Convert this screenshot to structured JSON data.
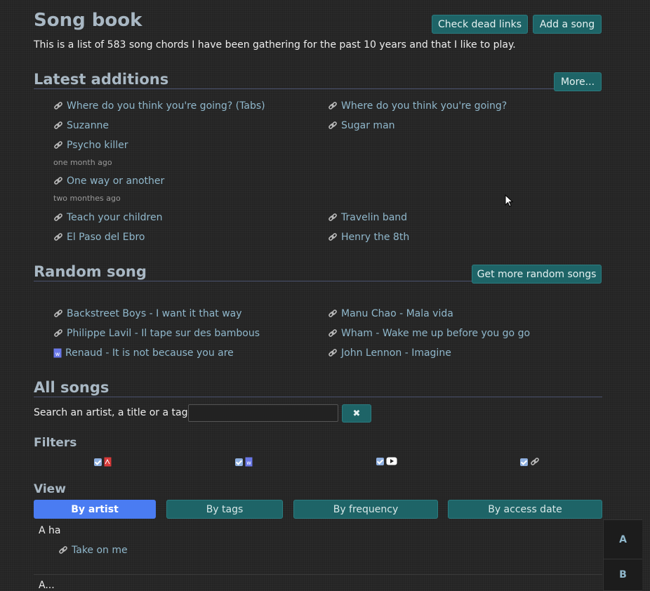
{
  "header": {
    "title": "Song book",
    "intro": "This is a list of 583 song chords I have been gathering for the past 10 years and that I like to play.",
    "check_dead_links": "Check dead links",
    "add_song": "Add a song"
  },
  "latest": {
    "title": "Latest additions",
    "more": "More...",
    "songs": [
      "Where do you think you're going? (Tabs)",
      "Where do you think you're going?",
      "Suzanne",
      "Sugar man",
      "Psycho killer",
      "One way or another",
      "Teach your children",
      "Travelin band",
      "El Paso del Ebro",
      "Henry the 8th"
    ],
    "dates": [
      "one month ago",
      "two monthes ago"
    ]
  },
  "random": {
    "title": "Random song",
    "more": "Get more random songs",
    "songs": [
      "Backstreet Boys - I want it that way",
      "Manu Chao - Mala vida",
      "Philippe Lavil - Il tape sur des bambous",
      "Wham - Wake me up before you go go",
      "Renaud - It is not because you are",
      "John Lennon - Imagine"
    ]
  },
  "all": {
    "title": "All songs",
    "search_label": "Search an artist, a title or a tag:",
    "search_value": "",
    "clear": "✖",
    "filters_title": "Filters",
    "view_title": "View",
    "tabs": [
      "By artist",
      "By tags",
      "By frequency",
      "By access date"
    ],
    "active_tab": "By artist",
    "artist": "A ha",
    "artist_song": "Take on me",
    "next_artist": "A..."
  },
  "index_letters": [
    "A",
    "B"
  ],
  "colors": {
    "accent": "#1e6467",
    "active_tab": "#4a7cf2",
    "link": "#90b8cc",
    "heading": "#a9b8c4"
  }
}
